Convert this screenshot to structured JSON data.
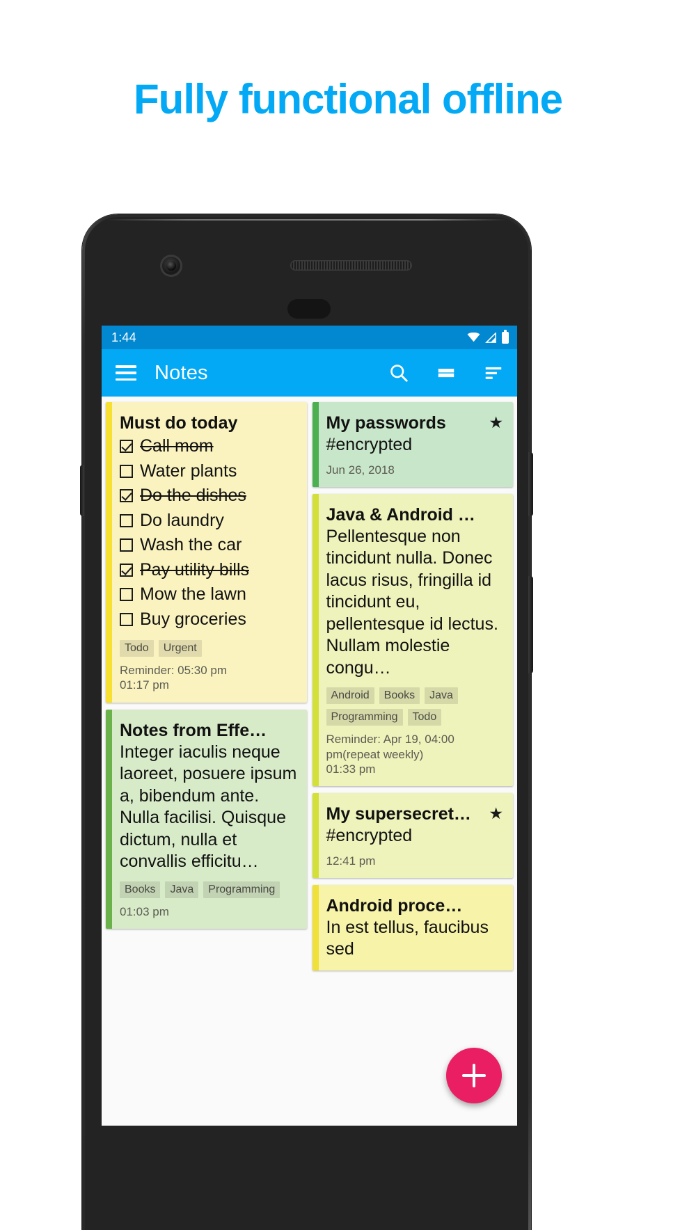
{
  "headline": "Fully functional offline",
  "colors": {
    "accent": "#03a9f4",
    "status_bar": "#0288d1",
    "fab": "#e91e63",
    "note_yellow": "#faf3c0",
    "note_green": "#c8e6c9",
    "note_lime": "#eef2bb",
    "stripe_yellow": "#f7e032",
    "stripe_green": "#4caf50",
    "stripe_lime": "#d4e03a"
  },
  "status_bar": {
    "time": "1:44",
    "icons": [
      "wifi-icon",
      "signal-icon",
      "battery-icon"
    ]
  },
  "toolbar": {
    "menu_icon": "hamburger-menu-icon",
    "title": "Notes",
    "actions": [
      {
        "name": "search-icon",
        "label": "Search"
      },
      {
        "name": "layout-view-icon",
        "label": "Layout"
      },
      {
        "name": "sort-icon",
        "label": "Sort"
      }
    ]
  },
  "fab": {
    "icon": "plus-icon",
    "label": "Add note"
  },
  "nav_bar": {
    "back": "back-triangle-icon",
    "home": "home-circle-icon",
    "recents": "recents-square-icon"
  },
  "notes": {
    "left_column": [
      {
        "id": "must-do-today",
        "title": "Must do today",
        "color": "#faf3c0",
        "stripe": "#f7e032",
        "starred": false,
        "type": "checklist",
        "items": [
          {
            "text": "Call mom",
            "checked": true
          },
          {
            "text": "Water plants",
            "checked": false
          },
          {
            "text": "Do the dishes",
            "checked": true
          },
          {
            "text": "Do laundry",
            "checked": false
          },
          {
            "text": "Wash the car",
            "checked": false
          },
          {
            "text": "Pay utility bills",
            "checked": true
          },
          {
            "text": "Mow the lawn",
            "checked": false
          },
          {
            "text": "Buy groceries",
            "checked": false
          }
        ],
        "tags": [
          "Todo",
          "Urgent"
        ],
        "meta": [
          "Reminder: 05:30 pm",
          "01:17 pm"
        ]
      },
      {
        "id": "notes-from-effective-java",
        "title": "Notes from Effe…",
        "color": "#d8ebc9",
        "stripe": "#6cb24a",
        "starred": false,
        "type": "text",
        "body": "Integer iaculis neque laoreet, posuere ipsum a, bibendum ante. Nulla facilisi. Quisque dictum, nulla et convallis efficitu…",
        "tags": [
          "Books",
          "Java",
          "Programming"
        ],
        "meta": [
          "01:03 pm"
        ]
      }
    ],
    "right_column": [
      {
        "id": "my-passwords",
        "title": "My passwords",
        "color": "#c8e6c9",
        "stripe": "#4caf50",
        "starred": true,
        "type": "text",
        "body": "#encrypted",
        "tags": [],
        "meta": [
          "Jun 26, 2018"
        ]
      },
      {
        "id": "java-and-android",
        "title": "Java & Android …",
        "color": "#eef2bb",
        "stripe": "#d4e03a",
        "starred": false,
        "type": "text",
        "body": "Pellentesque non tincidunt nulla. Donec lacus risus, fringilla id tincidunt eu, pellentesque id lectus. Nullam molestie congu…",
        "tags": [
          "Android",
          "Books",
          "Java",
          "Programming",
          "Todo"
        ],
        "meta": [
          "Reminder: Apr 19, 04:00 pm(repeat weekly)",
          "01:33 pm"
        ]
      },
      {
        "id": "my-supersecret",
        "title": "My supersecret…",
        "color": "#eef2bb",
        "stripe": "#d4e03a",
        "starred": true,
        "type": "text",
        "body": "#encrypted",
        "tags": [],
        "meta": [
          "12:41 pm"
        ]
      },
      {
        "id": "android-proce",
        "title": "Android proce…",
        "color": "#f7f3a8",
        "stripe": "#f0e03a",
        "starred": false,
        "type": "text",
        "body": "In est tellus, faucibus sed",
        "tags": [],
        "meta": []
      }
    ]
  }
}
